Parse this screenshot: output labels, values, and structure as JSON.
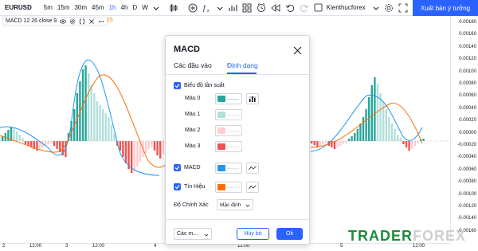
{
  "toolbar": {
    "symbol": "EURUSD",
    "intervals": [
      {
        "label": "5m",
        "active": false
      },
      {
        "label": "15m",
        "active": false
      },
      {
        "label": "30m",
        "active": false
      },
      {
        "label": "45m",
        "active": false
      },
      {
        "label": "1h",
        "active": true
      },
      {
        "label": "4h",
        "active": false
      },
      {
        "label": "D",
        "active": false
      },
      {
        "label": "W",
        "active": false
      }
    ],
    "username": "Kienthucforex",
    "publish_label": "Xuất bản ý tưởng"
  },
  "legend": {
    "text": "MACD 12 26 close 9",
    "value": "15"
  },
  "price_axis": [
    "0.00180",
    "0.00160",
    "0.00140",
    "0.00120",
    "0.00100",
    "0.00080",
    "0.00060",
    "0.00040",
    "0.00020",
    "0.00000",
    "-0.00020",
    "-0.00040",
    "-0.00060",
    "-0.00080",
    "-0.00100",
    "-0.00120",
    "-0.00140",
    "-0.00160"
  ],
  "current_values": [
    "0.00020",
    "0.00000"
  ],
  "time_axis": [
    "2",
    "12:00",
    "3",
    "12:00",
    "4",
    "12:00",
    "5",
    "12:00"
  ],
  "colors": {
    "accent": "#2962ff",
    "hist_up_strong": "#26a69a",
    "hist_up_weak": "#b2dfdb",
    "hist_down_weak": "#ffcdd2",
    "hist_down_strong": "#ef5350",
    "macd_line": "#2196f3",
    "signal_line": "#ff6d00"
  },
  "dialog": {
    "title": "MACD",
    "tabs": [
      "Các đầu vào",
      "Định dạng"
    ],
    "active_tab": "Định dạng",
    "histogram_label": "Biểu đồ tần suất",
    "colors": [
      {
        "label": "Màu 0",
        "color": "#26a69a"
      },
      {
        "label": "Màu 1",
        "color": "#b2dfdb"
      },
      {
        "label": "Màu 2",
        "color": "#ffcdd2"
      },
      {
        "label": "Màu 3",
        "color": "#ef5350"
      }
    ],
    "macd_label": "MACD",
    "macd_color": "#2196f3",
    "signal_label": "Tín Hiệu",
    "signal_color": "#ff6d00",
    "precision_label": "Độ Chính Xác",
    "precision_value": "Mặc định",
    "defaults_label": "Các m...",
    "cancel_label": "Hủy bỏ",
    "ok_label": "Ok"
  },
  "watermark": {
    "part1": "TRADER",
    "part2": "FOREX"
  }
}
